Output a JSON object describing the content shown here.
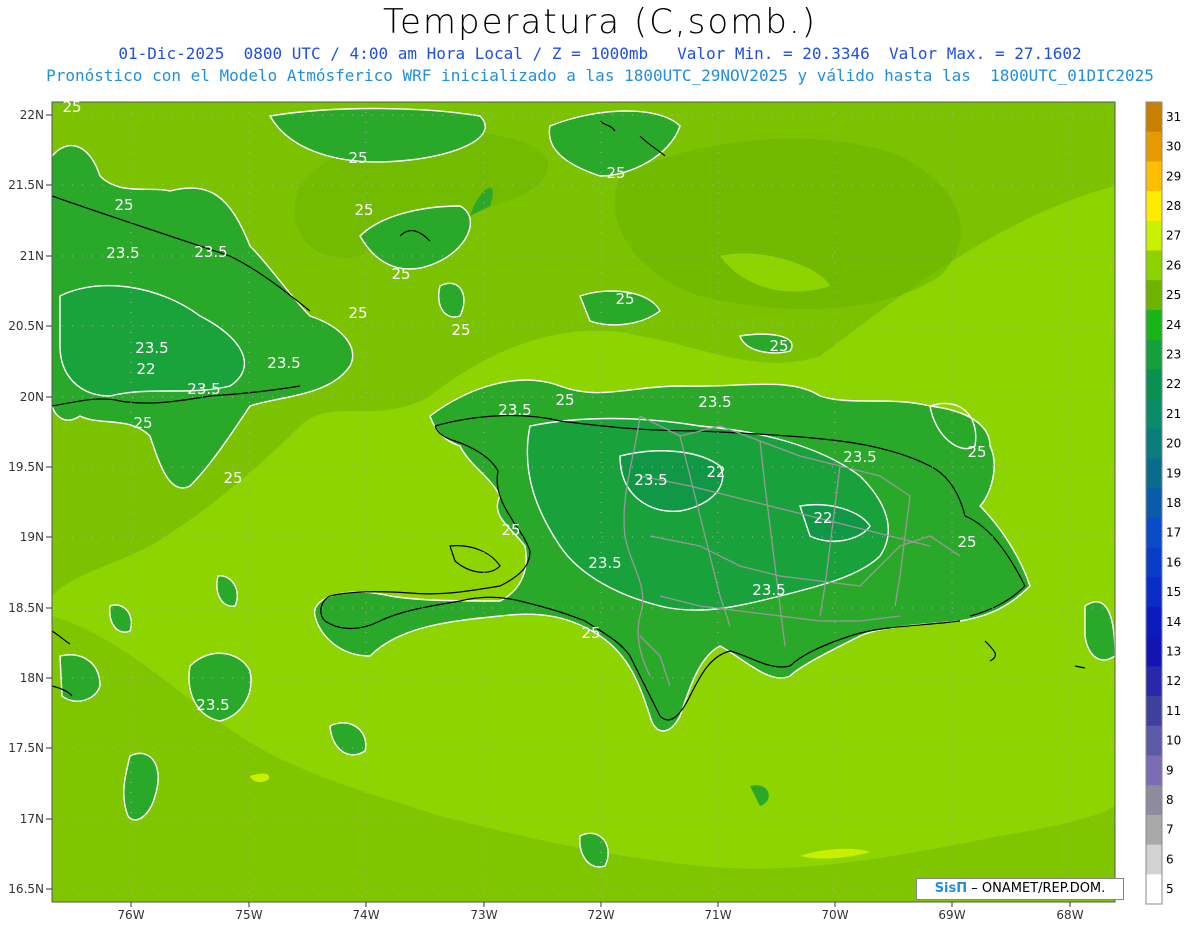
{
  "header": {
    "title": "Temperatura (C,somb.)",
    "info_line": "01-Dic-2025  0800 UTC / 4:00 am Hora Local / Z = 1000mb   Valor Min. = 20.3346  Valor Max. = 27.1602",
    "model_line": "Pronóstico con el Modelo Atmósferico WRF inicializado a las 1800UTC_29NOV2025 y válido hasta las  1800UTC_01DIC2025"
  },
  "map": {
    "lat_labels": [
      "22N",
      "21.5N",
      "21N",
      "20.5N",
      "20N",
      "19.5N",
      "19N",
      "18.5N",
      "18N",
      "17.5N",
      "17N",
      "16.5N"
    ],
    "lon_labels": [
      "76W",
      "75W",
      "74W",
      "73W",
      "72W",
      "71W",
      "70W",
      "69W",
      "68W"
    ],
    "contour_labels": [
      "25",
      "25",
      "25",
      "25",
      "25",
      "25",
      "25",
      "25",
      "25",
      "25",
      "25",
      "25",
      "25",
      "25",
      "25",
      "25",
      "25",
      "23.5",
      "23.5",
      "23.5",
      "23.5",
      "23.5",
      "23.5",
      "23.5",
      "23.5",
      "23.5",
      "23.5",
      "23.5",
      "23.5",
      "22",
      "22",
      "22"
    ],
    "colors": {
      "ocean": "#8ed400",
      "band_25": "#6cb400",
      "land_24": "#2aa82a",
      "land_23": "#16a040",
      "contour": "#ffffff",
      "border": "#999999",
      "coast": "#000000"
    }
  },
  "colorbar": {
    "labels": [
      "31",
      "30",
      "29",
      "28",
      "27",
      "26",
      "25",
      "24",
      "23",
      "22",
      "21",
      "20",
      "19",
      "18",
      "17",
      "16",
      "15",
      "14",
      "13",
      "12",
      "11",
      "10",
      "9",
      "8",
      "7",
      "6",
      "5"
    ],
    "colors": [
      "#c88000",
      "#e69a00",
      "#ffbe00",
      "#ffeb00",
      "#c8f000",
      "#8cd200",
      "#6cb400",
      "#18b418",
      "#16a03c",
      "#0a9050",
      "#0a8c6a",
      "#0a7c7c",
      "#0a6c8c",
      "#0a5caa",
      "#0a4cc8",
      "#0a3cc8",
      "#0a2cc8",
      "#0a1cc0",
      "#1414b4",
      "#2828a8",
      "#40409c",
      "#5a5aa6",
      "#7c6cb4",
      "#8c8c9c",
      "#a8a8a8",
      "#d2d2d2",
      "#ffffff"
    ]
  },
  "footer": {
    "logo_text": "SisΠ",
    "credit": "– ONAMET/REP.DOM."
  }
}
